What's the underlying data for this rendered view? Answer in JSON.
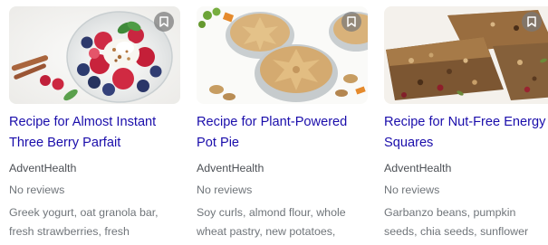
{
  "recipes": [
    {
      "title_line1": "Recipe for Almost Instant",
      "title_line2": "Three Berry Parfait",
      "source": "AdventHealth",
      "reviews": "No reviews",
      "ingredients_line1": "Greek yogurt, oat granola bar,",
      "ingredients_line2": "fresh strawberries, fresh",
      "image_subject": "berry parfait in glass dish"
    },
    {
      "title_line1": "Recipe for Plant-Powered",
      "title_line2": "Pot Pie",
      "source": "AdventHealth",
      "reviews": "No reviews",
      "ingredients_line1": "Soy curls, almond flour, whole",
      "ingredients_line2": "wheat pastry, new potatoes,",
      "image_subject": "pot pies with star-shaped crust"
    },
    {
      "title_line1": "Recipe for Nut-Free Energy",
      "title_line2": "Squares",
      "source": "AdventHealth",
      "reviews": "No reviews",
      "ingredients_line1": "Garbanzo beans, pumpkin",
      "ingredients_line2": "seeds, chia seeds, sunflower",
      "image_subject": "granola energy squares"
    }
  ],
  "icons": {
    "save": "bookmark-icon"
  },
  "colors": {
    "title_link": "#1a0dab",
    "source_text": "#4d5156",
    "meta_text": "#70757a",
    "save_button_bg": "#787878"
  }
}
